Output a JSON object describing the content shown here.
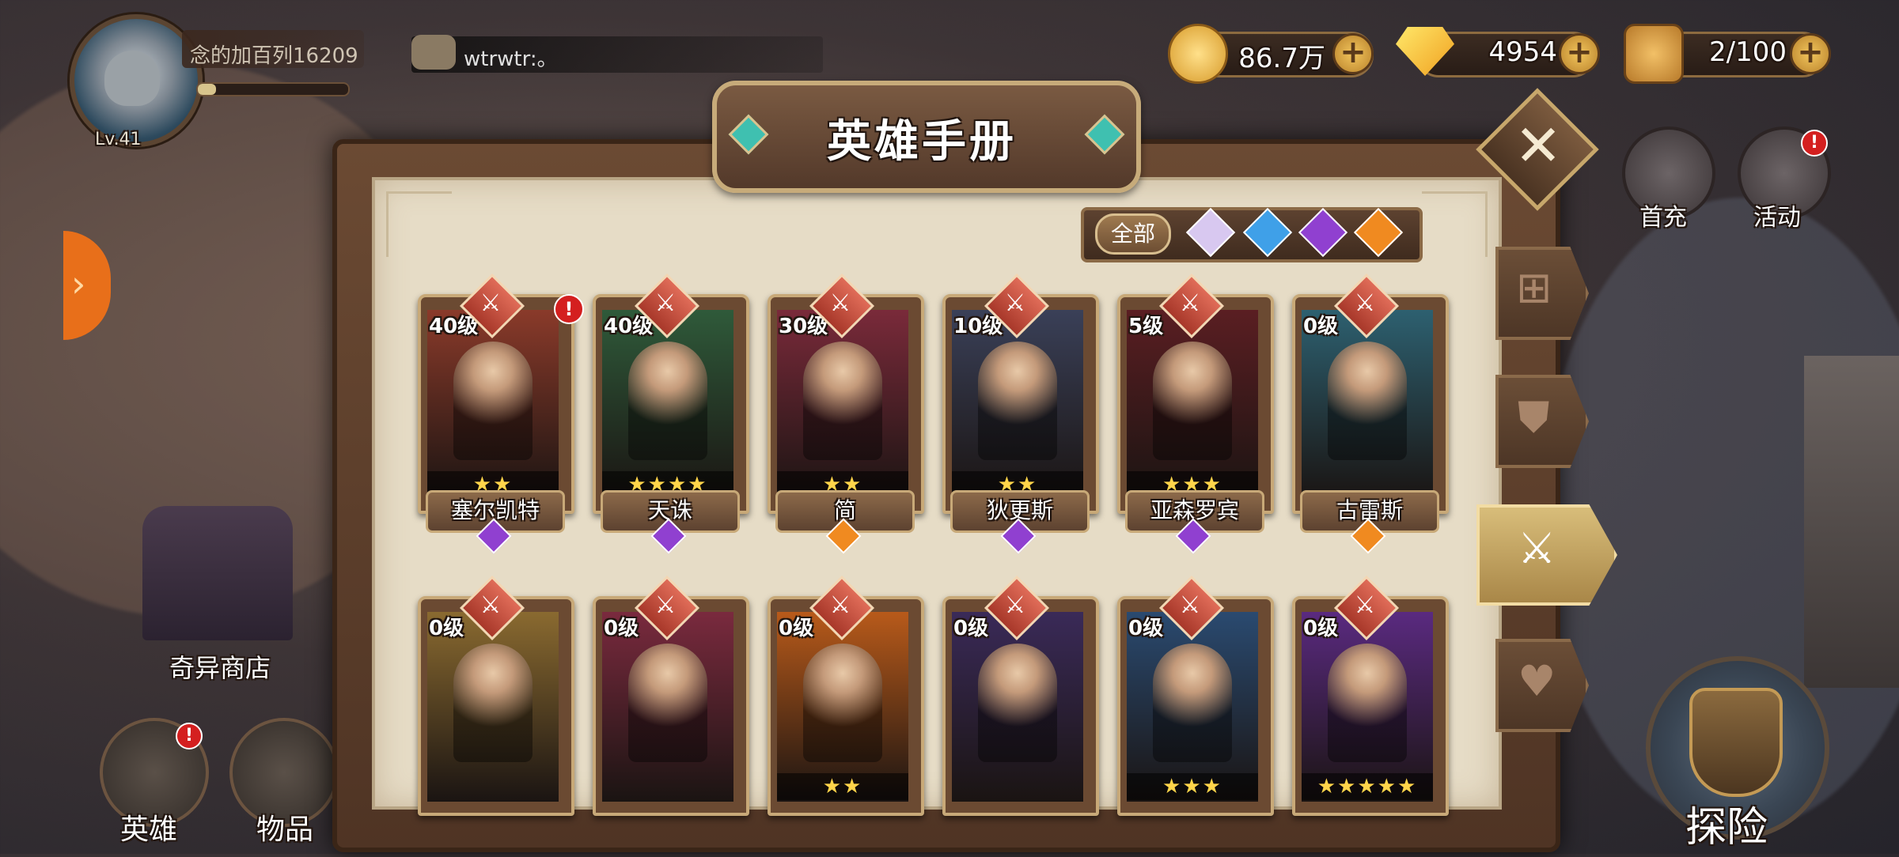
{
  "player": {
    "name": "念的加百列16209",
    "level": "Lv.41",
    "exp_fraction": 0.12
  },
  "chat": {
    "message": "wtrwtr:。"
  },
  "currencies": [
    {
      "name": "gold",
      "icon": "gold-coin-icon",
      "value": "86.7万"
    },
    {
      "name": "diamond",
      "icon": "diamond-icon",
      "value": "4954"
    },
    {
      "name": "stamina",
      "icon": "food-icon",
      "value": "2/100"
    }
  ],
  "right_menu": [
    {
      "label": "首充",
      "icon": "panda-icon",
      "alert": false
    },
    {
      "label": "活动",
      "icon": "event-icon",
      "alert": true,
      "alert_text": "!"
    }
  ],
  "left_menu": {
    "shop_label": "奇异商店",
    "nav": [
      {
        "label": "英雄",
        "icon": "helmet-icon",
        "alert": true,
        "alert_text": "!"
      },
      {
        "label": "物品",
        "icon": "bag-icon",
        "alert": false
      }
    ]
  },
  "adventure": {
    "label": "探险"
  },
  "panel": {
    "title": "英雄手册",
    "filter_all_label": "全部",
    "filters": [
      {
        "name": "white-gem-filter",
        "color": "#d8c8f0"
      },
      {
        "name": "blue-gem-filter",
        "color": "#3fa0e8"
      },
      {
        "name": "purple-gem-filter",
        "color": "#9040d0"
      },
      {
        "name": "orange-gem-filter",
        "color": "#f08a20"
      }
    ],
    "side_tabs": [
      {
        "name": "tab-grid",
        "icon": "grid-icon",
        "active": false
      },
      {
        "name": "tab-shield",
        "icon": "shield-icon",
        "active": false
      },
      {
        "name": "tab-sword",
        "icon": "sword-icon",
        "active": true
      },
      {
        "name": "tab-heart",
        "icon": "heart-icon",
        "active": false
      }
    ],
    "heroes": [
      {
        "level": "40级",
        "name": "塞尔凯特",
        "stars": "★★",
        "rarity": "purple",
        "alert": true,
        "alert_text": "!",
        "color": "#8a3a2a"
      },
      {
        "level": "40级",
        "name": "天诛",
        "stars": "★★★★",
        "rarity": "purple",
        "alert": false,
        "color": "#2f5a3a"
      },
      {
        "level": "30级",
        "name": "简",
        "stars": "★★",
        "rarity": "orange",
        "alert": false,
        "color": "#7a2a3a"
      },
      {
        "level": "10级",
        "name": "狄更斯",
        "stars": "★★",
        "rarity": "purple",
        "alert": false,
        "color": "#3a4058"
      },
      {
        "level": "5级",
        "name": "亚森罗宾",
        "stars": "★★★",
        "rarity": "purple",
        "alert": false,
        "color": "#5a1e22"
      },
      {
        "level": "0级",
        "name": "古雷斯",
        "stars": "",
        "rarity": "orange",
        "alert": false,
        "color": "#2d6070"
      },
      {
        "level": "0级",
        "name": "",
        "stars": "",
        "rarity": "",
        "alert": false,
        "color": "#8a6a30"
      },
      {
        "level": "0级",
        "name": "",
        "stars": "",
        "rarity": "",
        "alert": false,
        "color": "#7a2a3e"
      },
      {
        "level": "0级",
        "name": "",
        "stars": "★★",
        "rarity": "",
        "alert": false,
        "color": "#b85a1a"
      },
      {
        "level": "0级",
        "name": "",
        "stars": "",
        "rarity": "",
        "alert": false,
        "color": "#3a2a58"
      },
      {
        "level": "0级",
        "name": "",
        "stars": "★★★",
        "rarity": "",
        "alert": false,
        "color": "#2a4a70"
      },
      {
        "level": "0级",
        "name": "",
        "stars": "★★★★★",
        "rarity": "",
        "alert": false,
        "color": "#5a2a80"
      }
    ]
  }
}
